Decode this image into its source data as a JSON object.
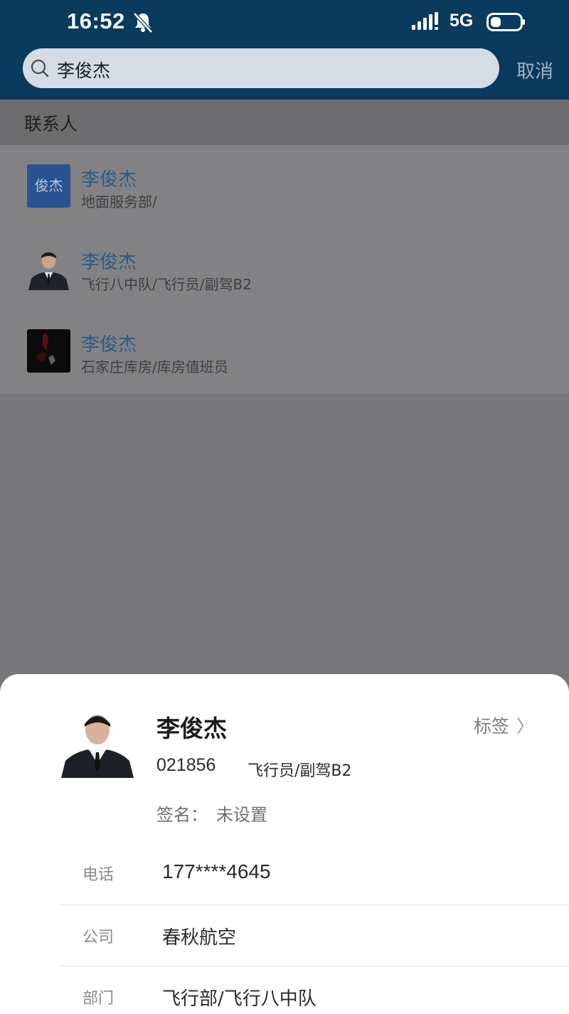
{
  "status_bar": {
    "time": "16:52",
    "network": "5G",
    "icons": [
      "bell-muted-icon",
      "signal-icon",
      "battery-icon"
    ]
  },
  "search": {
    "query": "李俊杰",
    "cancel_label": "取消"
  },
  "results": {
    "section_title": "联系人",
    "items": [
      {
        "name": "李俊杰",
        "dept": "地面服务部/",
        "avatar_text": "俊杰"
      },
      {
        "name": "李俊杰",
        "dept": "飞行八中队/飞行员/副驾B2",
        "avatar_text": ""
      },
      {
        "name": "李俊杰",
        "dept": "石家庄库房/库房值班员",
        "avatar_text": ""
      }
    ]
  },
  "card": {
    "name": "李俊杰",
    "tag_label": "标签",
    "employee_id": "021856",
    "role": "飞行员/副驾B2",
    "signature_label": "签名：",
    "signature_value": "未设置",
    "fields": [
      {
        "label": "电话",
        "value": "177****4645"
      },
      {
        "label": "公司",
        "value": "春秋航空"
      },
      {
        "label": "部门",
        "value": "飞行部/飞行八中队"
      }
    ]
  },
  "colors": {
    "topbar": "#0a3a5c",
    "overlay_bg": "#777779",
    "link_name": "#2c5a85",
    "avatar_blue": "#2b5290"
  }
}
